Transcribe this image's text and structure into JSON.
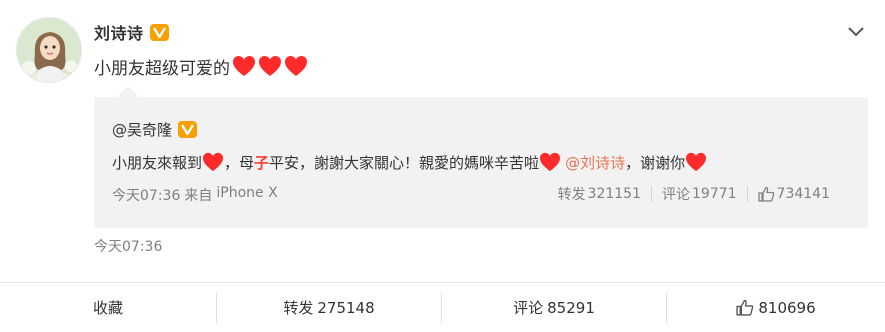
{
  "post": {
    "author_name": "刘诗诗",
    "text": "小朋友超级可爱的",
    "heart_count": 3,
    "time": "今天07:36"
  },
  "repost": {
    "author_name": "@吴奇隆",
    "text_part1": "小朋友來報到",
    "text_part2": "，母",
    "text_highlight": "子",
    "text_part3": "平安，謝謝大家關心！親愛的媽咪辛苦啦",
    "mention": "@刘诗诗",
    "text_part4": "，谢谢你",
    "time": "今天07:36",
    "source_prefix": "来自",
    "source": "iPhone X",
    "repost_label": "转发",
    "repost_count": "321151",
    "comment_label": "评论",
    "comment_count": "19771",
    "like_count": "734141"
  },
  "footer": {
    "favorite_label": "收藏",
    "repost_label": "转发",
    "repost_count": "275148",
    "comment_label": "评论",
    "comment_count": "85291",
    "like_count": "810696"
  },
  "colors": {
    "heart": "#ff2a2a",
    "badge": "#f7a000",
    "mention": "#eb7350",
    "repost_bg": "#f2f2f2"
  },
  "icons": [
    "avatar",
    "verified-v-icon",
    "chevron-down-icon",
    "heart-icon",
    "thumbs-up-icon"
  ]
}
